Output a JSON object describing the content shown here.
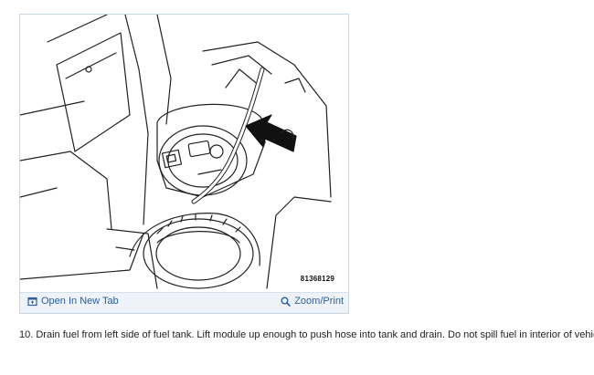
{
  "figure": {
    "image_label": "81368129",
    "open_tab_label": "Open In New Tab",
    "open_tab_icon": "open-new-tab-icon",
    "zoom_label": "Zoom/Print",
    "zoom_icon": "magnifier-icon",
    "accent_color": "#2c5f9a",
    "toolbar_color": "#eef3f9"
  },
  "caption": {
    "text": "10. Drain fuel from left side of fuel tank. Lift module up enough to push hose into tank and drain. Do not spill fuel in interior of vehicle."
  }
}
